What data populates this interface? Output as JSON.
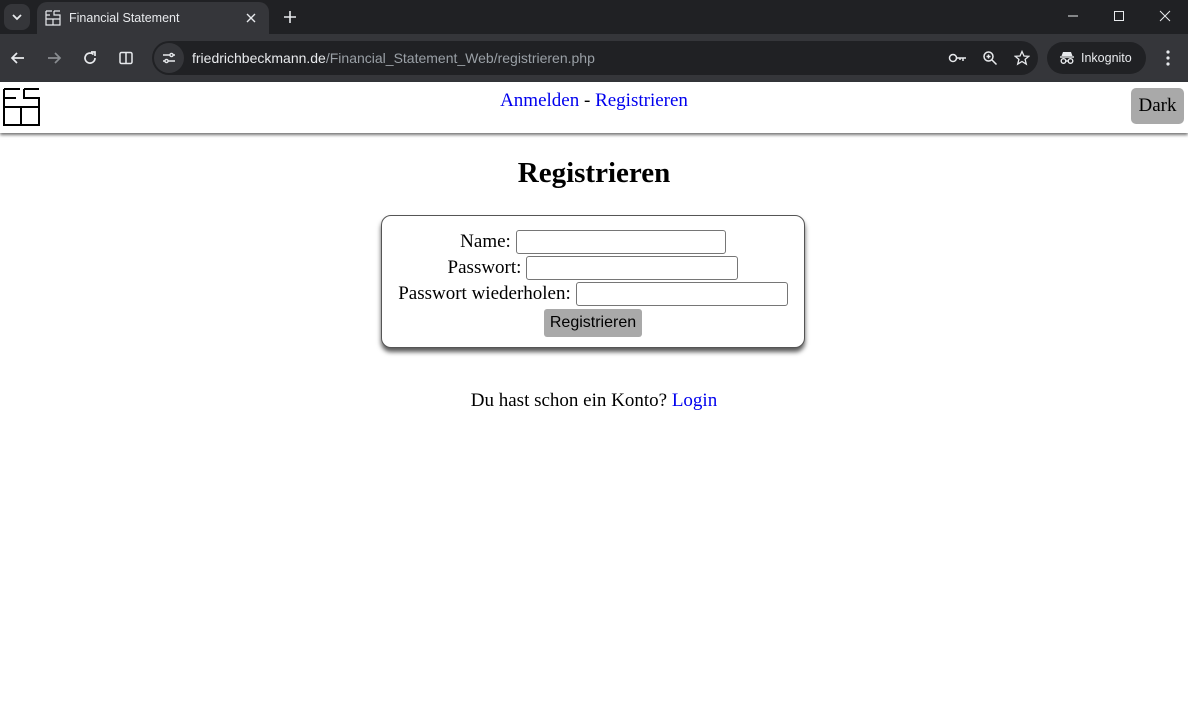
{
  "browser": {
    "tab_title": "Financial Statement",
    "url_host": "friedrichbeckmann.de",
    "url_path": "/Financial_Statement_Web/registrieren.php",
    "incognito_label": "Inkognito",
    "icons": [
      "tab-search-icon",
      "favicon-icon",
      "close-icon",
      "plus-icon",
      "minimize-icon",
      "maximize-icon",
      "window-close-icon",
      "back-icon",
      "forward-icon",
      "reload-icon",
      "split-view-icon",
      "site-info-icon",
      "password-key-icon",
      "zoom-icon",
      "star-icon",
      "incognito-icon",
      "kebab-menu-icon"
    ]
  },
  "header": {
    "nav_login": "Anmelden",
    "nav_separator": "-",
    "nav_register": "Registrieren",
    "dark_label": "Dark"
  },
  "main": {
    "title": "Registrieren",
    "form": {
      "name_label": "Name:",
      "name_value": "",
      "password_label": "Passwort:",
      "password_value": "",
      "password_repeat_label": "Passwort wiederholen:",
      "password_repeat_value": "",
      "submit_label": "Registrieren"
    },
    "login_prompt": "Du hast schon ein Konto?",
    "login_link": "Login"
  },
  "colors": {
    "link": "#0000ee",
    "button_gray": "#a9a9a9",
    "chrome_dark": "#202124",
    "chrome_toolbar": "#35363a"
  }
}
